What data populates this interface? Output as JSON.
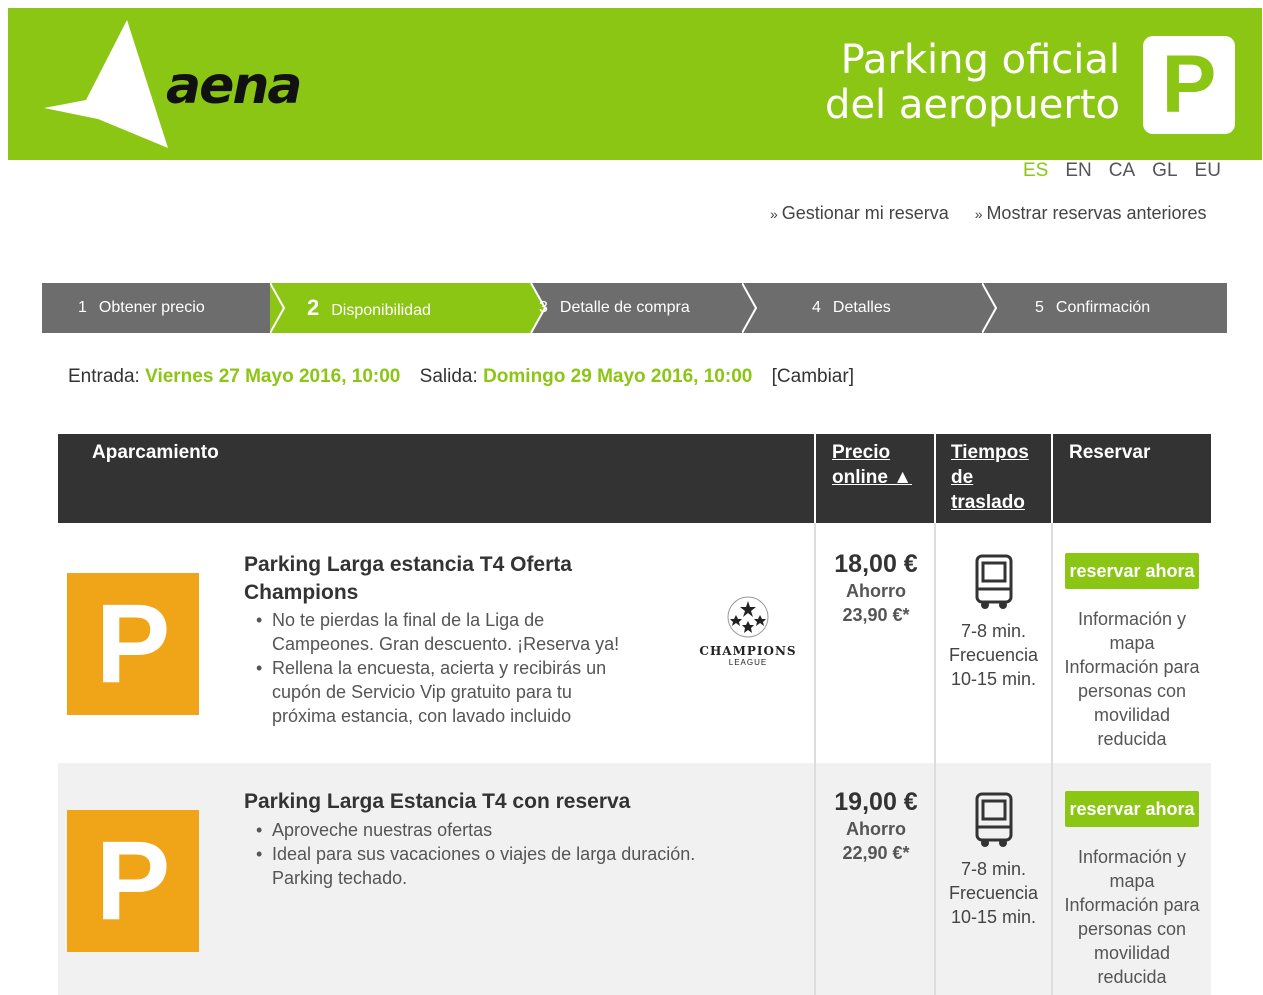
{
  "brand": {
    "name": "aena",
    "title_line1": "Parking oficial",
    "title_line2": "del aeropuerto",
    "badge": "P",
    "accent": "#8cc614"
  },
  "languages": [
    {
      "code": "ES",
      "active": true
    },
    {
      "code": "EN",
      "active": false
    },
    {
      "code": "CA",
      "active": false
    },
    {
      "code": "GL",
      "active": false
    },
    {
      "code": "EU",
      "active": false
    }
  ],
  "toplinks": [
    "Gestionar mi reserva",
    "Mostrar reservas anteriores"
  ],
  "steps": [
    {
      "num": "1",
      "label": "Obtener precio"
    },
    {
      "num": "2",
      "label": "Disponibilidad",
      "active": true
    },
    {
      "num": "3",
      "label": "Detalle de compra"
    },
    {
      "num": "4",
      "label": "Detalles"
    },
    {
      "num": "5",
      "label": "Confirmación"
    }
  ],
  "dates": {
    "entry_label": "Entrada:",
    "entry_value": "Viernes 27 Mayo 2016, 10:00",
    "exit_label": "Salida:",
    "exit_value": "Domingo 29 Mayo 2016, 10:00",
    "change": "[Cambiar]"
  },
  "table": {
    "headers": {
      "parking": "Aparcamiento",
      "price_l1": "Precio",
      "price_l2": "online ▲",
      "time_l1": "Tiempos",
      "time_l2": "de",
      "time_l3": "traslado",
      "book": "Reservar"
    },
    "rows": [
      {
        "icon": "P",
        "title_l1": "Parking Larga estancia T4 Oferta",
        "title_l2": "Champions",
        "features": [
          {
            "l1": "No te pierdas la final de la Liga de",
            "l2": "Campeones. Gran descuento. ¡Reserva ya!"
          },
          {
            "l1": "Rellena la encuesta, acierta y recibirás un",
            "l2": "cupón de Servicio Vip gratuito para tu",
            "l3": "próxima estancia, con lavado incluido"
          }
        ],
        "logo_text1": "CHAMPIONS",
        "logo_text2": "LEAGUE",
        "price": "18,00 €",
        "saving_label": "Ahorro",
        "saving_value": "23,90 €*",
        "transfer": "7-8 min.",
        "frequency_label": "Frecuencia",
        "frequency": "10-15 min.",
        "book_button": "reservar ahora",
        "info_l1": "Información y",
        "info_l2": "mapa",
        "info_l3": "Información para",
        "info_l4": "personas con",
        "info_l5": "movilidad",
        "info_l6": "reducida"
      },
      {
        "icon": "P",
        "title_l1": "Parking Larga Estancia T4 con reserva",
        "features": [
          {
            "l1": "Aproveche nuestras ofertas"
          },
          {
            "l1": "Ideal para sus vacaciones o viajes de larga duración."
          }
        ],
        "note": "Parking techado.",
        "price": "19,00 €",
        "saving_label": "Ahorro",
        "saving_value": "22,90 €*",
        "transfer": "7-8 min.",
        "frequency_label": "Frecuencia",
        "frequency": "10-15 min.",
        "book_button": "reservar ahora",
        "info_l1": "Información y",
        "info_l2": "mapa",
        "info_l3": "Información para",
        "info_l4": "personas con",
        "info_l5": "movilidad",
        "info_l6": "reducida"
      }
    ]
  }
}
